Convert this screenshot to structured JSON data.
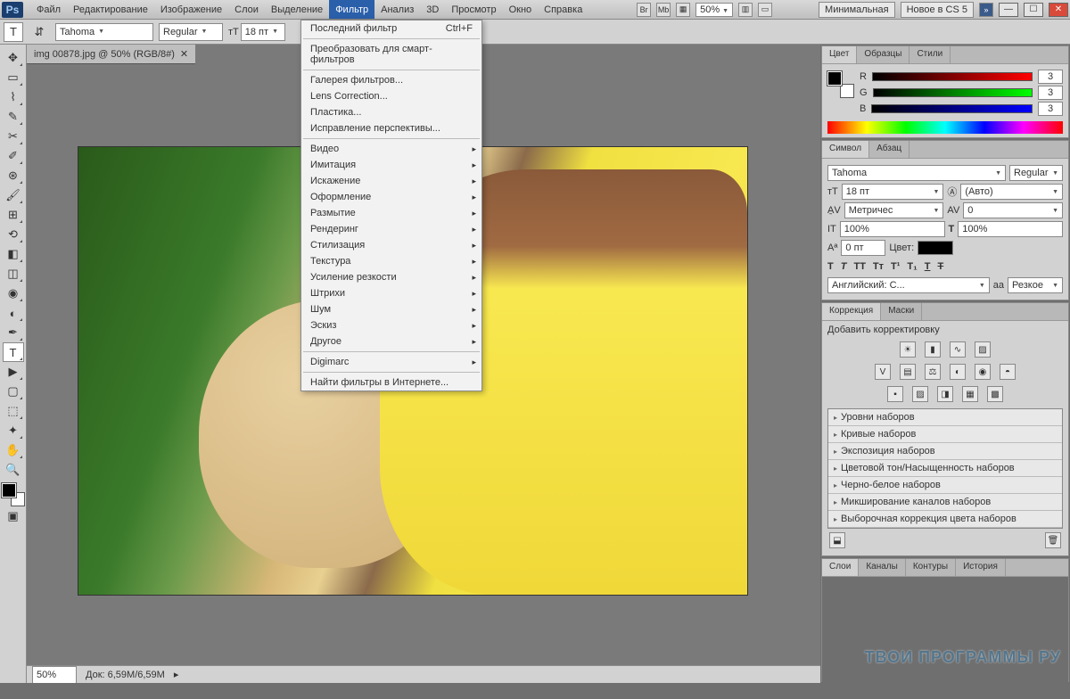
{
  "app": {
    "logo": "Ps"
  },
  "menubar": [
    "Файл",
    "Редактирование",
    "Изображение",
    "Слои",
    "Выделение",
    "Фильтр",
    "Анализ",
    "3D",
    "Просмотр",
    "Окно",
    "Справка"
  ],
  "menubar_active_index": 5,
  "titlebar": {
    "zoom": "50%",
    "workspace": "Минимальная",
    "whatsnew": "Новое в CS 5"
  },
  "optionsbar": {
    "font": "Tahoma",
    "style": "Regular",
    "size": "18 пт"
  },
  "document": {
    "tab": "img 00878.jpg @ 50% (RGB/8#)"
  },
  "statusbar": {
    "zoom": "50%",
    "docinfo": "Док: 6,59M/6,59M"
  },
  "filter_menu": {
    "recent": {
      "label": "Последний фильтр",
      "shortcut": "Ctrl+F"
    },
    "items1": [
      "Преобразовать для смарт-фильтров"
    ],
    "items2": [
      "Галерея фильтров...",
      "Lens Correction...",
      "Пластика...",
      "Исправление перспективы..."
    ],
    "submenus": [
      "Видео",
      "Имитация",
      "Искажение",
      "Оформление",
      "Размытие",
      "Рендеринг",
      "Стилизация",
      "Текстура",
      "Усиление резкости",
      "Штрихи",
      "Шум",
      "Эскиз",
      "Другое"
    ],
    "items3": [
      "Digimarc"
    ],
    "items4": [
      "Найти фильтры в Интернете..."
    ]
  },
  "panels": {
    "color": {
      "tabs": [
        "Цвет",
        "Образцы",
        "Стили"
      ],
      "channels": [
        {
          "l": "R",
          "v": "3"
        },
        {
          "l": "G",
          "v": "3"
        },
        {
          "l": "B",
          "v": "3"
        }
      ]
    },
    "character": {
      "tabs": [
        "Символ",
        "Абзац"
      ],
      "font": "Tahoma",
      "style": "Regular",
      "size": "18 пт",
      "leading": "(Авто)",
      "tracking": "Метричес",
      "kerning": "0",
      "vscale": "100%",
      "hscale": "100%",
      "baseline": "0 пт",
      "color_label": "Цвет:",
      "lang": "Английский: С...",
      "aa_label": "aа",
      "aa": "Резкое"
    },
    "adjustments": {
      "tabs": [
        "Коррекция",
        "Маски"
      ],
      "add": "Добавить корректировку",
      "presets": [
        "Уровни наборов",
        "Кривые наборов",
        "Экспозиция наборов",
        "Цветовой тон/Насыщенность наборов",
        "Черно-белое наборов",
        "Микширование каналов наборов",
        "Выборочная коррекция цвета наборов"
      ]
    },
    "layers": {
      "tabs": [
        "Слои",
        "Каналы",
        "Контуры",
        "История"
      ]
    }
  },
  "watermark": "ТВОИ ПРОГРАММЫ РУ"
}
